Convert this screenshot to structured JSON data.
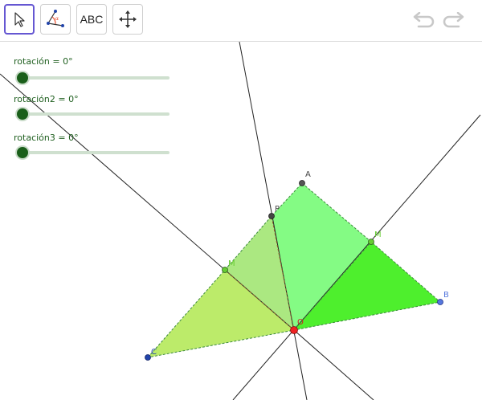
{
  "toolbar": {
    "text_tool_label": "ABC",
    "icons": [
      "cursor-arrow-icon",
      "angle-tool-icon",
      "text-tool-icon",
      "move-view-icon",
      "undo-icon",
      "redo-icon"
    ]
  },
  "sliders": [
    {
      "label": "rotación = 0°",
      "value": 0
    },
    {
      "label": "rotación2 = 0°",
      "value": 0
    },
    {
      "label": "rotación3 = 0°",
      "value": 0
    }
  ],
  "points": {
    "A": "A",
    "B": "B",
    "C": "C",
    "M1": "M",
    "M2": "M",
    "P": "P",
    "O": "O"
  },
  "colors": {
    "active_tool_border": "#6557d2",
    "slider_knob": "#1a5f1a",
    "triangle_left": "#b8ea62",
    "triangle_middle": "#7dfb7d",
    "triangle_right": "#44ee22",
    "point_green": "#66cc33",
    "point_blue": "#5577dd",
    "point_red": "#ee2222"
  }
}
